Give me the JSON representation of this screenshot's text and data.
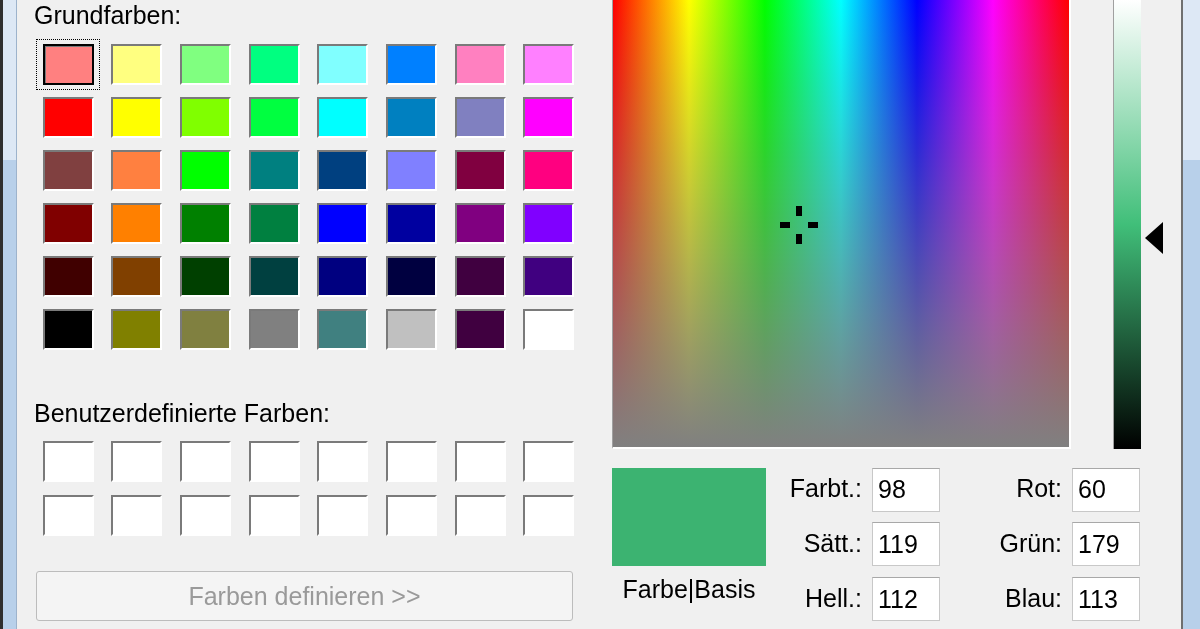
{
  "basic_colors": {
    "label": "Grundfarben:",
    "swatches": [
      {
        "color": "#ff8080",
        "selected": true
      },
      {
        "color": "#ffff80",
        "selected": false
      },
      {
        "color": "#80ff80",
        "selected": false
      },
      {
        "color": "#00ff80",
        "selected": false
      },
      {
        "color": "#80ffff",
        "selected": false
      },
      {
        "color": "#0080ff",
        "selected": false
      },
      {
        "color": "#ff80c0",
        "selected": false
      },
      {
        "color": "#ff80ff",
        "selected": false
      },
      {
        "color": "#ff0000",
        "selected": false
      },
      {
        "color": "#ffff00",
        "selected": false
      },
      {
        "color": "#80ff00",
        "selected": false
      },
      {
        "color": "#00ff40",
        "selected": false
      },
      {
        "color": "#00ffff",
        "selected": false
      },
      {
        "color": "#0080c0",
        "selected": false
      },
      {
        "color": "#8080c0",
        "selected": false
      },
      {
        "color": "#ff00ff",
        "selected": false
      },
      {
        "color": "#804040",
        "selected": false
      },
      {
        "color": "#ff8040",
        "selected": false
      },
      {
        "color": "#00ff00",
        "selected": false
      },
      {
        "color": "#008080",
        "selected": false
      },
      {
        "color": "#004080",
        "selected": false
      },
      {
        "color": "#8080ff",
        "selected": false
      },
      {
        "color": "#800040",
        "selected": false
      },
      {
        "color": "#ff0080",
        "selected": false
      },
      {
        "color": "#800000",
        "selected": false
      },
      {
        "color": "#ff8000",
        "selected": false
      },
      {
        "color": "#008000",
        "selected": false
      },
      {
        "color": "#008040",
        "selected": false
      },
      {
        "color": "#0000ff",
        "selected": false
      },
      {
        "color": "#0000a0",
        "selected": false
      },
      {
        "color": "#800080",
        "selected": false
      },
      {
        "color": "#8000ff",
        "selected": false
      },
      {
        "color": "#400000",
        "selected": false
      },
      {
        "color": "#804000",
        "selected": false
      },
      {
        "color": "#004000",
        "selected": false
      },
      {
        "color": "#004040",
        "selected": false
      },
      {
        "color": "#000080",
        "selected": false
      },
      {
        "color": "#000040",
        "selected": false
      },
      {
        "color": "#400040",
        "selected": false
      },
      {
        "color": "#400080",
        "selected": false
      },
      {
        "color": "#000000",
        "selected": false
      },
      {
        "color": "#808000",
        "selected": false
      },
      {
        "color": "#808040",
        "selected": false
      },
      {
        "color": "#808080",
        "selected": false
      },
      {
        "color": "#408080",
        "selected": false
      },
      {
        "color": "#c0c0c0",
        "selected": false
      },
      {
        "color": "#400040",
        "selected": false
      },
      {
        "color": "#ffffff",
        "selected": false
      }
    ]
  },
  "custom_colors": {
    "label": "Benutzerdefinierte Farben:",
    "swatches": [
      {
        "color": "#ffffff",
        "selected": false
      },
      {
        "color": "#ffffff",
        "selected": false
      },
      {
        "color": "#ffffff",
        "selected": false
      },
      {
        "color": "#ffffff",
        "selected": false
      },
      {
        "color": "#ffffff",
        "selected": false
      },
      {
        "color": "#ffffff",
        "selected": false
      },
      {
        "color": "#ffffff",
        "selected": false
      },
      {
        "color": "#ffffff",
        "selected": false
      },
      {
        "color": "#ffffff",
        "selected": false
      },
      {
        "color": "#ffffff",
        "selected": false
      },
      {
        "color": "#ffffff",
        "selected": false
      },
      {
        "color": "#ffffff",
        "selected": false
      },
      {
        "color": "#ffffff",
        "selected": false
      },
      {
        "color": "#ffffff",
        "selected": false
      },
      {
        "color": "#ffffff",
        "selected": false
      },
      {
        "color": "#ffffff",
        "selected": false
      }
    ]
  },
  "define_colors_button": {
    "label": "Farben definieren >>",
    "disabled": true
  },
  "luminance_slider": {
    "level": 0.47
  },
  "preview": {
    "label": "Farbe|Basis"
  },
  "hsl_fields": [
    {
      "label": "Farbt.:",
      "value": "98"
    },
    {
      "label": "Sätt.:",
      "value": "119"
    },
    {
      "label": "Hell.:",
      "value": "112"
    }
  ],
  "rgb_fields": [
    {
      "label": "Rot:",
      "value": "60"
    },
    {
      "label": "Grün:",
      "value": "179"
    },
    {
      "label": "Blau:",
      "value": "113"
    }
  ]
}
